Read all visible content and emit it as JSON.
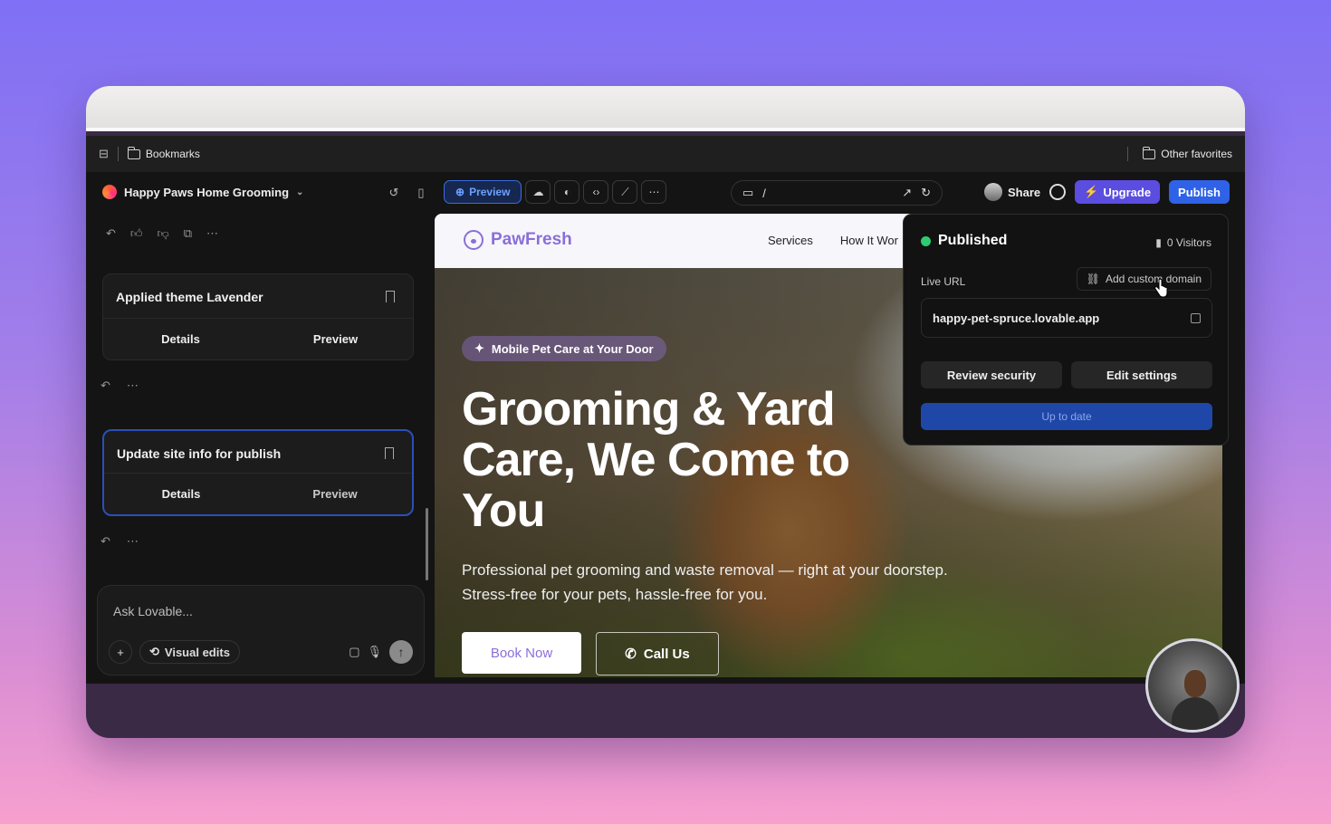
{
  "bookmarks_bar": {
    "bookmarks_label": "Bookmarks",
    "other_favorites_label": "Other favorites"
  },
  "topbar": {
    "project_name": "Happy Paws Home Grooming",
    "preview_label": "Preview",
    "url_path": "/",
    "share_label": "Share",
    "upgrade_label": "Upgrade",
    "publish_label": "Publish"
  },
  "chat": {
    "cards": [
      {
        "title": "Applied theme Lavender",
        "details_label": "Details",
        "preview_label": "Preview"
      },
      {
        "title": "Update site info for publish",
        "details_label": "Details",
        "preview_label": "Preview"
      }
    ],
    "composer": {
      "placeholder": "Ask Lovable...",
      "visual_edits_label": "Visual edits"
    }
  },
  "site": {
    "brand": "PawFresh",
    "nav": [
      "Services",
      "How It Wor"
    ],
    "tag": "Mobile Pet Care at Your Door",
    "hero_title": "Grooming & Yard Care, We Come to You",
    "hero_sub": "Professional pet grooming and waste removal — right at your doorstep. Stress-free for your pets, hassle-free for you.",
    "book_label": "Book Now",
    "call_label": "Call Us"
  },
  "publish_popover": {
    "status": "Published",
    "visitors": "0 Visitors",
    "live_url_label": "Live URL",
    "custom_domain_label": "Add custom domain",
    "url": "happy-pet-spruce.lovable.app",
    "review_security_label": "Review security",
    "edit_settings_label": "Edit settings",
    "up_to_date_label": "Up to date"
  },
  "colors": {
    "accent_blue": "#2f62e6",
    "upgrade_purple": "#5b4de0",
    "brand_lavender": "#8a6fd8",
    "published_green": "#2ecc71"
  }
}
